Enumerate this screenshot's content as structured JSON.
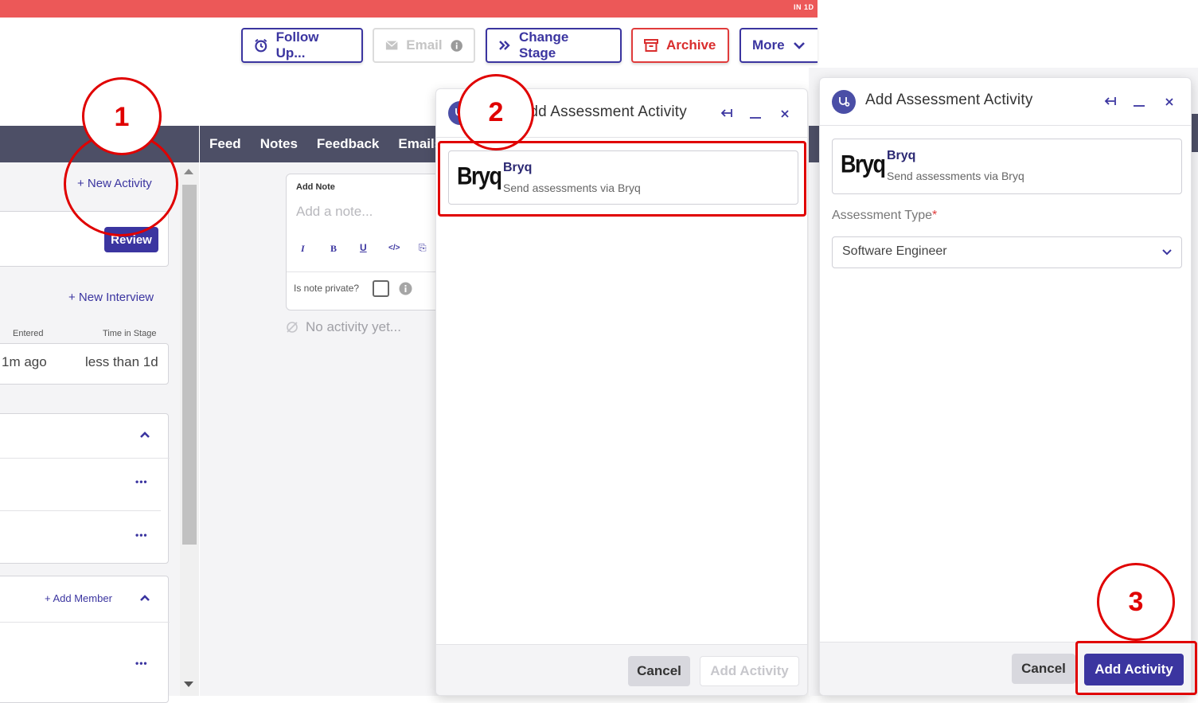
{
  "topbar": {
    "text": "IN 1D",
    "color": "#ec5858"
  },
  "toolbar": {
    "follow_up": "Follow Up...",
    "email": "Email",
    "change_stage": "Change Stage",
    "archive": "Archive",
    "more": "More"
  },
  "left": {
    "new_activity": "+ New Activity",
    "review": "Review",
    "new_interview": "+ New Interview",
    "col_entered": "Entered",
    "col_time_in_stage": "Time in Stage",
    "entered_value": "1m ago",
    "time_in_stage_value": "less than 1d",
    "add_member": "+ Add Member",
    "more_dots": "•••"
  },
  "center": {
    "tabs": [
      "Feed",
      "Notes",
      "Feedback",
      "Emails"
    ],
    "add_note_label": "Add Note",
    "add_note_placeholder": "Add a note...",
    "format_buttons": [
      "I",
      "B",
      "U",
      "</>",
      "⎘"
    ],
    "private_label": "Is note private?",
    "no_activity": "No activity yet..."
  },
  "modal_partial": {
    "title": "Add Assessment Activity",
    "provider_logo": "Bryq",
    "provider_name": "Bryq",
    "provider_desc": "Send assessments via Bryq",
    "cancel": "Cancel",
    "add_activity": "Add Activity"
  },
  "modal_full": {
    "title": "Add Assessment Activity",
    "provider_logo": "Bryq",
    "provider_name": "Bryq",
    "provider_desc": "Send assessments via Bryq",
    "assessment_type_label": "Assessment Type",
    "required_marker": "*",
    "assessment_type_value": "Software Engineer",
    "cancel": "Cancel",
    "add_activity": "Add Activity"
  },
  "annotations": {
    "step1": "1",
    "step2": "2",
    "step3": "3"
  },
  "colors": {
    "brand": "#3b35a0",
    "danger": "#d92d2d",
    "annotation": "#e00000",
    "header_dark": "#4d4f66"
  }
}
